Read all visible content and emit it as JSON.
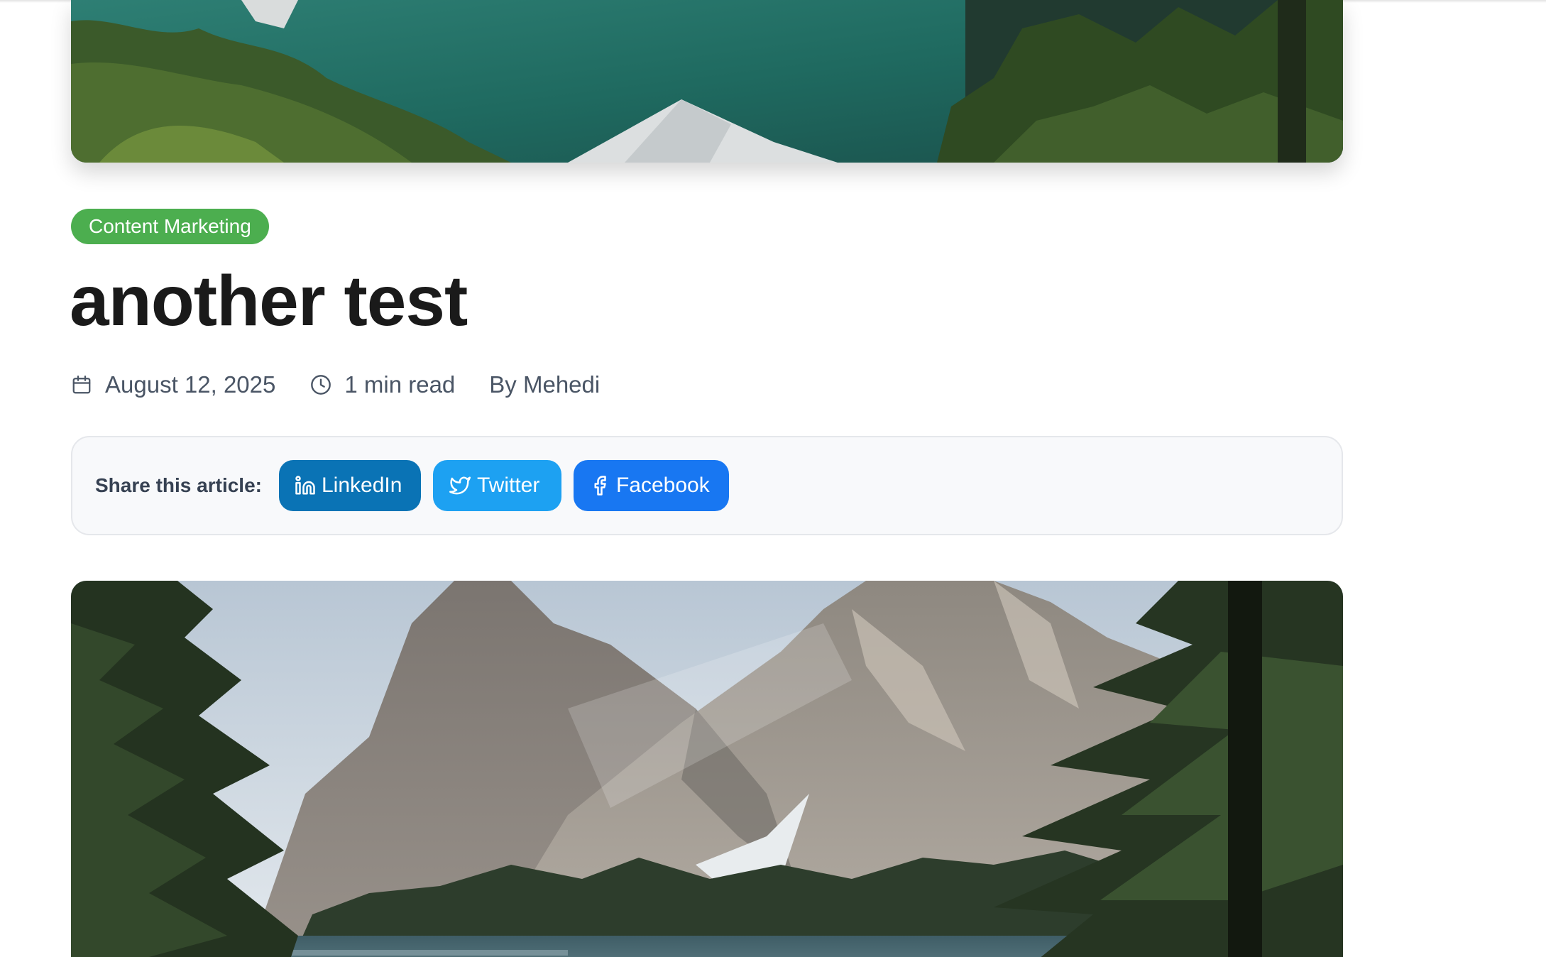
{
  "post": {
    "category": "Content Marketing",
    "title": "another test",
    "date": "August 12, 2025",
    "read_time": "1 min read",
    "author": "By Mehedi"
  },
  "share": {
    "label": "Share this article:",
    "buttons": [
      {
        "label": "LinkedIn",
        "icon": "linkedin-icon",
        "color": "#0a73b5"
      },
      {
        "label": "Twitter",
        "icon": "twitter-icon",
        "color": "#1da1f2"
      },
      {
        "label": "Facebook",
        "icon": "facebook-icon",
        "color": "#1877f2"
      }
    ]
  },
  "colors": {
    "badge": "#4cae4f",
    "title": "#1a1a1a",
    "meta_text": "#4a5565",
    "share_box_bg": "#f8f9fb"
  },
  "icons": {
    "date": "calendar-icon",
    "read_time": "clock-icon"
  }
}
